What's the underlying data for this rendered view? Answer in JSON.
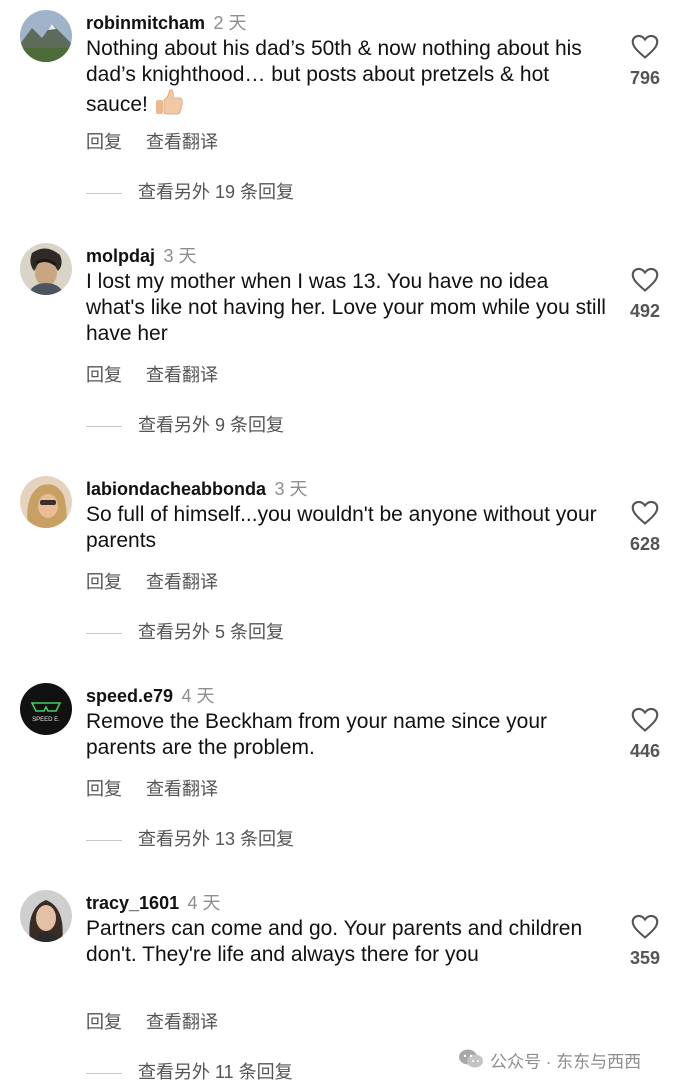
{
  "comments": [
    {
      "username": "robinmitcham",
      "time": "2 天",
      "text": "Nothing about his dad’s 50th & now nothing about his dad’s knighthood… but posts about pretzels & hot sauce!",
      "emoji": "thumbs-up",
      "likes": "796",
      "reply_label": "回复",
      "translate_label": "查看翻译",
      "more_replies": "查看另外 19 条回复"
    },
    {
      "username": "molpdaj",
      "time": "3 天",
      "text": "I lost my mother when I was 13. You have no idea what's like not having her. Love your mom while you still have her",
      "likes": "492",
      "reply_label": "回复",
      "translate_label": "查看翻译",
      "more_replies": "查看另外 9 条回复"
    },
    {
      "username": "labiondacheabbonda",
      "time": "3 天",
      "text": "So full of himself...you wouldn't be anyone without your parents",
      "likes": "628",
      "reply_label": "回复",
      "translate_label": "查看翻译",
      "more_replies": "查看另外 5 条回复"
    },
    {
      "username": "speed.e79",
      "time": "4 天",
      "text": "Remove the Beckham from your name since your parents are the problem.",
      "likes": "446",
      "reply_label": "回复",
      "translate_label": "查看翻译",
      "more_replies": "查看另外 13 条回复",
      "avatar_text": "SPEED E."
    },
    {
      "username": "tracy_1601",
      "time": "4 天",
      "text": "Partners can come and go. Your parents and children don't. They're life and always there for you",
      "likes": "359",
      "reply_label": "回复",
      "translate_label": "查看翻译",
      "more_replies": "查看另外 11 条回复"
    }
  ],
  "watermark": {
    "text": "公众号 · 东东与西西",
    "icon": "wechat-icon"
  },
  "icons": {
    "like": "heart-outline-icon"
  },
  "colors": {
    "text": "#111111",
    "secondary": "#8e8e8e",
    "action": "#555555"
  }
}
